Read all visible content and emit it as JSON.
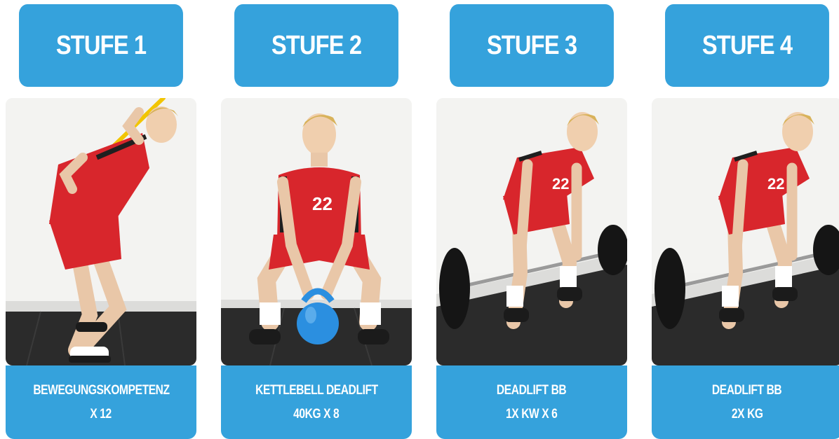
{
  "stages": [
    {
      "title": "STUFE 1",
      "exercise": "BEWEGUNGSKOMPETENZ",
      "detail": "X 12"
    },
    {
      "title": "STUFE 2",
      "exercise": "KETTLEBELL DEADLIFT",
      "detail": "40KG X 8"
    },
    {
      "title": "STUFE 3",
      "exercise": "DEADLIFT BB",
      "detail": "1X KW X 6"
    },
    {
      "title": "STUFE 4",
      "exercise": "DEADLIFT BB",
      "detail": "2X KG"
    }
  ],
  "jersey_number": "22",
  "colors": {
    "accent": "#35a2dc",
    "jersey": "#d8262c",
    "kettlebell": "#2b8fe0",
    "floor": "#2a2a2a",
    "wall": "#f2f2f0"
  }
}
